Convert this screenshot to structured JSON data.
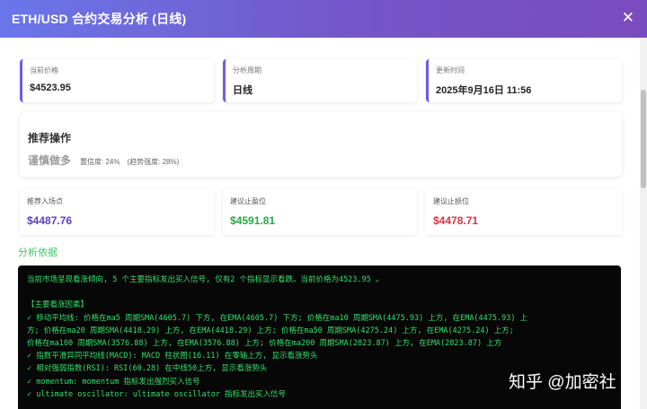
{
  "header": {
    "title": "ETH/USD 合约交易分析 (日线)",
    "close_icon": "close-icon"
  },
  "info": [
    {
      "label": "当前价格",
      "value": "$4523.95"
    },
    {
      "label": "分析周期",
      "value": "日线"
    },
    {
      "label": "更新时间",
      "value": "2025年9月16日 11:56"
    }
  ],
  "recommendation": {
    "heading": "推荐操作",
    "action": "谨慎做多",
    "confidence": "置信度: 24%",
    "trend_strength": "(趋势强度: 28%)"
  },
  "prices": [
    {
      "label": "推荐入场点",
      "value": "$4487.76",
      "color": "#5a3fc0"
    },
    {
      "label": "建议止盈位",
      "value": "$4591.81",
      "color": "#27a844"
    },
    {
      "label": "建议止损位",
      "value": "$4478.71",
      "color": "#dc3545"
    }
  ],
  "analysis": {
    "title": "分析依据",
    "lines": [
      "当前市场呈现看涨倾向, 5 个主要指标发出买入信号, 仅有2 个指标显示看跌。当前价格为4523.95 。",
      "",
      "【主要看涨因素】",
      "✓ 移动平均线:  价格在ma5 周期SMA(4605.7) 下方, 在EMA(4605.7) 下方;  价格在ma10 周期SMA(4475.93) 上方, 在EMA(4475.93) 上",
      "方;  价格在ma20 周期SMA(4418.29) 上方, 在EMA(4418.29) 上方;  价格在ma50 周期SMA(4275.24) 上方, 在EMA(4275.24) 上方;",
      "价格在ma100 周期SMA(3576.88) 上方, 在EMA(3576.88) 上方;  价格在ma200 周期SMA(2823.87) 上方, 在EMA(2823.87) 上方",
      "✓ 指数平滑异同平均线(MACD):  MACD 柱状图(16.11) 在零轴上方, 显示看涨势头",
      "✓ 相对强弱指数(RSI):  RSI(60.28) 在中线50上方, 显示看涨势头",
      "✓ momentum:  momentum 指标发出强烈买入信号",
      "✓ ultimate oscillator:  ultimate oscillator 指标发出买入信号"
    ]
  },
  "watermark": "知乎 @加密社"
}
